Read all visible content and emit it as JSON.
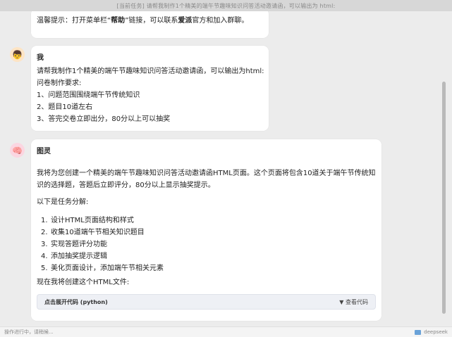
{
  "titlebar": {
    "title": "[当前任务] 请帮我制作1个精美的端午节趣味知识问答活动邀请函，可以输出为 html:"
  },
  "top_card": {
    "prefix": "温馨提示：打开菜单栏“",
    "help": "帮助",
    "middle": "”链接，可以联系",
    "brand": "爱派",
    "suffix": "官方和加入群聊。"
  },
  "user_msg": {
    "name": "我",
    "lines": [
      "请帮我制作1个精美的端午节趣味知识问答活动邀请函，可以输出为html:",
      "问卷制作要求:",
      "1、问题范围围绕端午节传统知识",
      "2、题目10道左右",
      "3、答完交卷立即出分，80分以上可以抽奖"
    ]
  },
  "bot_msg": {
    "name": "图灵",
    "intro": "我将为您创建一个精美的端午节趣味知识问答活动邀请函HTML页面。这个页面将包含10道关于端午节传统知识的选择题，答题后立即评分，80分以上显示抽奖提示。",
    "sub": "以下是任务分解:",
    "steps": [
      {
        "num": "1.",
        "text": "设计HTML页面结构和样式"
      },
      {
        "num": "2.",
        "text": "收集10道端午节相关知识题目"
      },
      {
        "num": "3.",
        "text": "实现答题评分功能"
      },
      {
        "num": "4.",
        "text": "添加抽奖提示逻辑"
      },
      {
        "num": "5.",
        "text": "美化页面设计，添加端午节相关元素"
      }
    ],
    "closing": "现在我将创建这个HTML文件:",
    "code_title": "点击展开代码 (python)",
    "code_toggle": "▼ 查看代码"
  },
  "statusbar": {
    "left": "操作进行中，请稍候...",
    "model": "deepseek"
  }
}
